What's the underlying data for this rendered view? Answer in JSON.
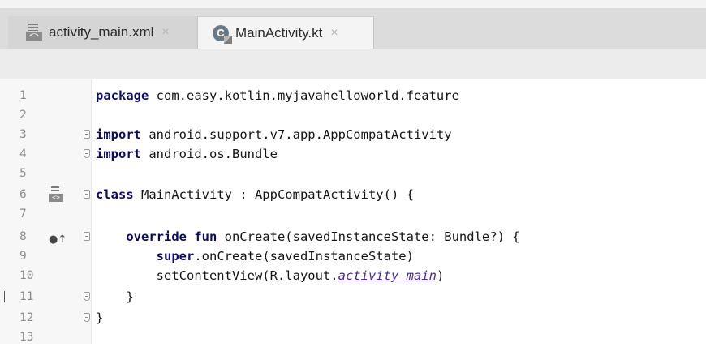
{
  "tabs": [
    {
      "label": "activity_main.xml",
      "icon": "xml-file-icon",
      "active": false,
      "close": "×"
    },
    {
      "label": "MainActivity.kt",
      "icon": "kotlin-class-icon",
      "active": true,
      "close": "×"
    }
  ],
  "gutter_icons": {
    "xml_badge": "<>",
    "kotlin_letter": "C"
  },
  "editor": {
    "lines": [
      {
        "num": "1",
        "code": "package com.easy.kotlin.myjavahelloworld.feature"
      },
      {
        "num": "2",
        "code": ""
      },
      {
        "num": "3",
        "code": "import android.support.v7.app.AppCompatActivity"
      },
      {
        "num": "4",
        "code": "import android.os.Bundle"
      },
      {
        "num": "5",
        "code": ""
      },
      {
        "num": "6",
        "code": "class MainActivity : AppCompatActivity() {"
      },
      {
        "num": "7",
        "code": ""
      },
      {
        "num": "8",
        "code": "    override fun onCreate(savedInstanceState: Bundle?) {"
      },
      {
        "num": "9",
        "code": "        super.onCreate(savedInstanceState)"
      },
      {
        "num": "10",
        "code": "        setContentView(R.layout.activity_main)"
      },
      {
        "num": "11",
        "code": "    }"
      },
      {
        "num": "12",
        "code": "}"
      },
      {
        "num": "13",
        "code": ""
      }
    ]
  }
}
